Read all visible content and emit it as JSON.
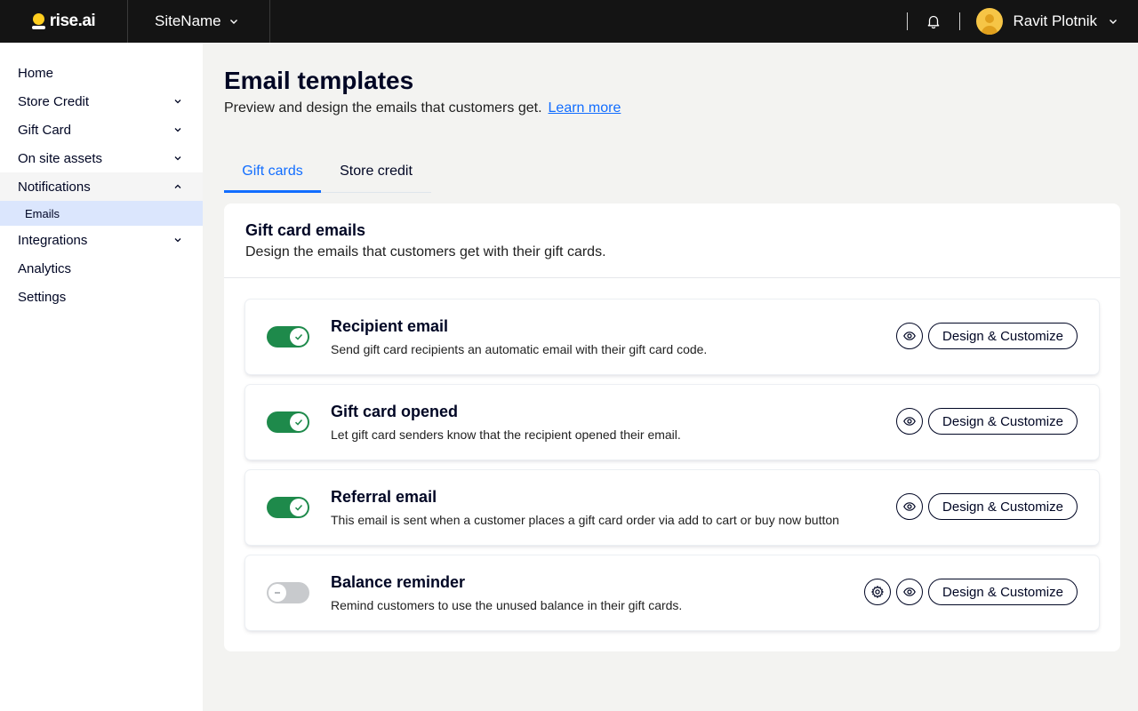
{
  "topbar": {
    "logo_text": "rise.ai",
    "site_name": "SiteName",
    "user_name": "Ravit Plotnik",
    "icons": {
      "bell": "bell-icon",
      "avatar": "avatar"
    }
  },
  "sidebar": {
    "items": [
      {
        "label": "Home"
      },
      {
        "label": "Store Credit"
      },
      {
        "label": "Gift Card"
      },
      {
        "label": "On site assets"
      },
      {
        "label": "Notifications"
      },
      {
        "label": "Emails"
      },
      {
        "label": "Integrations"
      },
      {
        "label": "Analytics"
      },
      {
        "label": "Settings"
      }
    ]
  },
  "page": {
    "title": "Email templates",
    "subtitle": "Preview and design the emails that customers get.",
    "learn_more": "Learn more"
  },
  "tabs": [
    {
      "label": "Gift cards",
      "active": true
    },
    {
      "label": "Store credit",
      "active": false
    }
  ],
  "card": {
    "title": "Gift card emails",
    "subtitle": "Design the emails that customers get with their gift cards.",
    "design_label": "Design & Customize",
    "rows": [
      {
        "title": "Recipient email",
        "desc": "Send gift card recipients an automatic email with their gift card code.",
        "enabled": true
      },
      {
        "title": "Gift card opened",
        "desc": "Let gift card senders know that the recipient opened their email.",
        "enabled": true
      },
      {
        "title": "Referral email",
        "desc": "This email is sent when a customer places a gift card order via add to cart or buy now button",
        "enabled": true
      },
      {
        "title": "Balance reminder",
        "desc": "Remind customers to use the unused balance in their gift cards.",
        "enabled": false
      }
    ]
  },
  "colors": {
    "accent": "#116dff",
    "toggle_on": "#1e8a4b",
    "toggle_off": "#c8cacd",
    "topbar": "#141414",
    "brand_yellow": "#ffce1f"
  }
}
